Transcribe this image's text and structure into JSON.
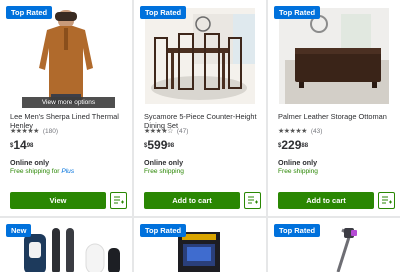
{
  "products": [
    {
      "badge": "Top Rated",
      "overlay": "View more options",
      "title": "Lee Men's Sherpa Lined Thermal Henley",
      "stars": "★★★★★",
      "reviews": "(180)",
      "price_currency": "$",
      "price_dollars": "14",
      "price_cents": "98",
      "availability": "Online only",
      "shipping": "Free shipping for ",
      "shipping_plus": "Plus",
      "button": "View"
    },
    {
      "badge": "Top Rated",
      "title": "Sycamore 5-Piece Counter-Height Dining Set",
      "stars": "★★★★☆",
      "reviews": "(47)",
      "price_currency": "$",
      "price_dollars": "599",
      "price_cents": "98",
      "availability": "Online only",
      "shipping": "Free shipping",
      "button": "Add to cart"
    },
    {
      "badge": "Top Rated",
      "title": "Palmer Leather Storage Ottoman",
      "stars": "★★★★★",
      "reviews": "(43)",
      "price_currency": "$",
      "price_dollars": "229",
      "price_cents": "88",
      "availability": "Online only",
      "shipping": "Free shipping",
      "button": "Add to cart"
    }
  ],
  "row2_badges": [
    "New",
    "Top Rated",
    "Top Rated"
  ],
  "icons": {
    "list": "add-to-list-icon"
  },
  "colors": {
    "badge": "#0071dc",
    "button": "#2a8703",
    "shipping": "#2a8703"
  }
}
